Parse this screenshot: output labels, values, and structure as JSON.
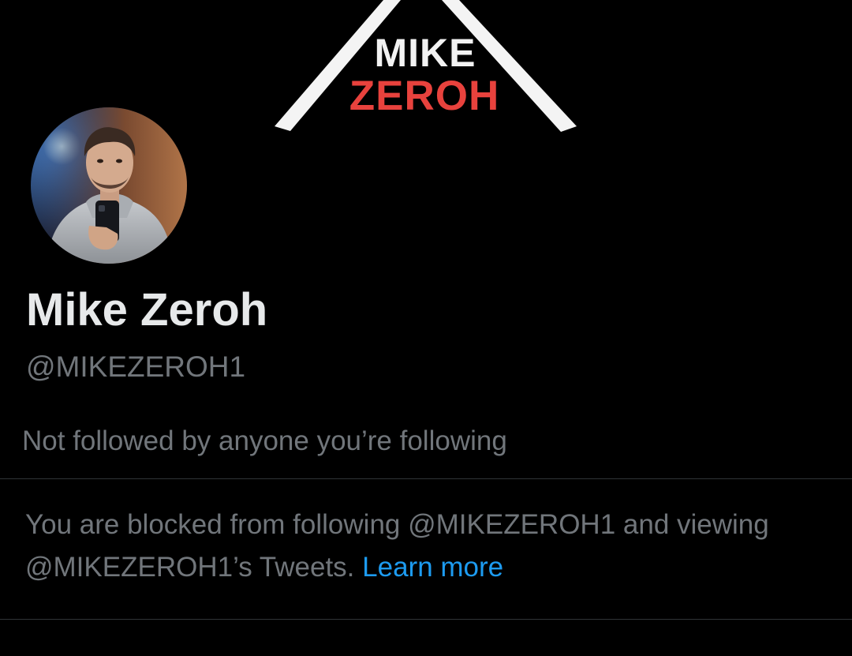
{
  "banner": {
    "logo_line1": "MIKE",
    "logo_line2": "ZEROH",
    "logo_line1_color": "#f2f2f2",
    "logo_line2_color": "#e8423d"
  },
  "profile": {
    "display_name": "Mike Zeroh",
    "handle": "@MIKEZEROH1",
    "followed_by": "Not followed by anyone you’re following"
  },
  "blocked": {
    "message": "You are blocked from following @MIKEZEROH1 and viewing @MIKEZEROH1’s Tweets.",
    "link_label": "Learn more",
    "link_color": "#1d9bf0"
  },
  "colors": {
    "background": "#000000",
    "primary_text": "#e7e9ea",
    "secondary_text": "#71767b",
    "divider": "#2f3336"
  }
}
